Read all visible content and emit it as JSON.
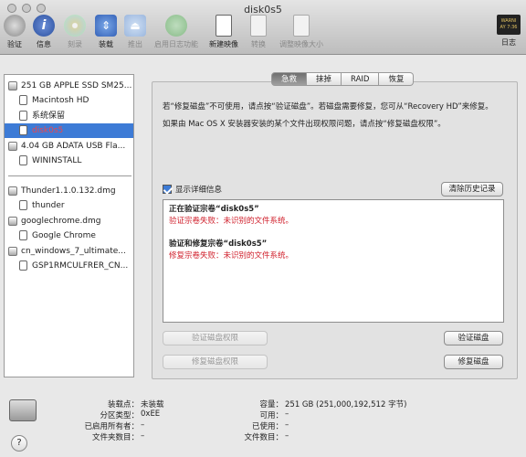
{
  "window": {
    "title": "disk0s5"
  },
  "toolbar": {
    "items": [
      {
        "label": "验证"
      },
      {
        "label": "信息"
      },
      {
        "label": "刻录"
      },
      {
        "label": "装载"
      },
      {
        "label": "推出"
      },
      {
        "label": "启用日志功能"
      },
      {
        "label": "新建映像"
      },
      {
        "label": "转换"
      },
      {
        "label": "调整映像大小"
      },
      {
        "label": "日志"
      }
    ],
    "log_badge": "WARNI\nAY 7:36"
  },
  "sidebar": {
    "items": [
      {
        "label": "251 GB APPLE SSD SM25..."
      },
      {
        "label": "Macintosh HD"
      },
      {
        "label": "系统保留"
      },
      {
        "label": "disk0s5"
      },
      {
        "label": "4.04 GB ADATA USB Fla..."
      },
      {
        "label": "WININSTALL"
      },
      {
        "label": "Thunder1.1.0.132.dmg"
      },
      {
        "label": "thunder"
      },
      {
        "label": "googlechrome.dmg"
      },
      {
        "label": "Google Chrome"
      },
      {
        "label": "cn_windows_7_ultimate..."
      },
      {
        "label": "GSP1RMCULFRER_CN..."
      }
    ]
  },
  "tabs": [
    {
      "label": "急救",
      "active": true
    },
    {
      "label": "抹掉",
      "active": false
    },
    {
      "label": "RAID",
      "active": false
    },
    {
      "label": "恢复",
      "active": false
    }
  ],
  "firstaid": {
    "info1": "若“修复磁盘”不可使用，请点按“验证磁盘”。若磁盘需要修复，您可从“Recovery HD”来修复。",
    "info2": "如果由 Mac OS X 安装器安装的某个文件出现权限问题，请点按“修复磁盘权限”。",
    "show_details": "显示详细信息",
    "clear_history": "清除历史记录",
    "log": [
      {
        "text": "正在验证宗卷“disk0s5”",
        "kind": "h"
      },
      {
        "text": "验证宗卷失败：未识别的文件系统。",
        "kind": "e"
      },
      {
        "text": "验证和修复宗卷“disk0s5”",
        "kind": "h"
      },
      {
        "text": "修复宗卷失败：未识别的文件系统。",
        "kind": "e"
      }
    ],
    "verify_permissions": "验证磁盘权限",
    "repair_permissions": "修复磁盘权限",
    "verify_disk": "验证磁盘",
    "repair_disk": "修复磁盘"
  },
  "footer": {
    "left": [
      {
        "key": "装载点：",
        "value": "未装载"
      },
      {
        "key": "分区类型：",
        "value": "0xEE"
      },
      {
        "key": "已启用所有者：",
        "value": "–"
      },
      {
        "key": "文件夹数目：",
        "value": "–"
      }
    ],
    "right": [
      {
        "key": "容量：",
        "value": "251 GB (251,000,192,512 字节)"
      },
      {
        "key": "可用：",
        "value": "–"
      },
      {
        "key": "已使用：",
        "value": "–"
      },
      {
        "key": "文件数目：",
        "value": "–"
      }
    ],
    "help": "?"
  },
  "colors": {
    "selection": "#3d7bd6",
    "error": "#d0202c",
    "selected_text": "#f0464b"
  }
}
